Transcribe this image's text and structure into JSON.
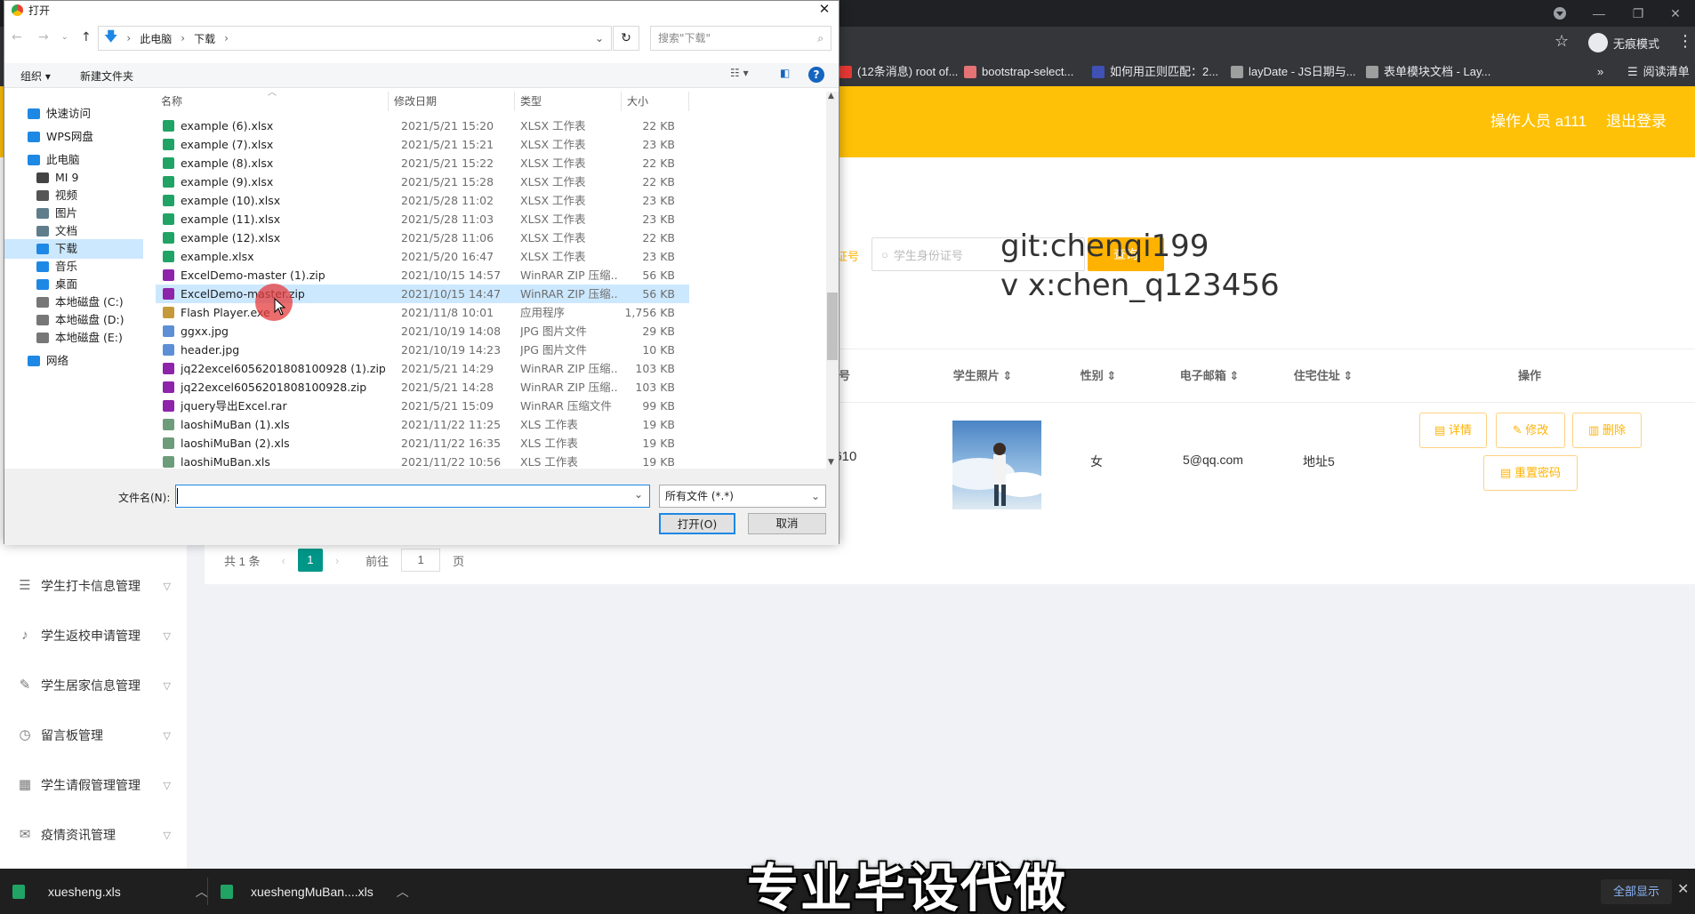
{
  "browser": {
    "incognito_label": "无痕模式",
    "reading_list_label": "阅读清单",
    "bookmarks": [
      "(12条消息) root of...",
      "bootstrap-select...",
      "如何用正则匹配：2...",
      "layDate - JS日期与...",
      "表单模块文档 - Lay..."
    ],
    "bookmark_more": "»",
    "colors": {
      "chrome_bg": "#202124",
      "toolbar_bg": "#35363a"
    }
  },
  "app": {
    "header": {
      "user_label": "操作人员 a111",
      "logout_label": "退出登录",
      "accent": "#ffc107"
    },
    "sidebar_items": [
      {
        "icon": "list-icon",
        "label": "学生打卡信息管理"
      },
      {
        "icon": "microphone-icon",
        "label": "学生返校申请管理"
      },
      {
        "icon": "pencil-icon",
        "label": "学生居家信息管理"
      },
      {
        "icon": "clock-icon",
        "label": "留言板管理"
      },
      {
        "icon": "grid-icon",
        "label": "学生请假管理管理"
      },
      {
        "icon": "mail-icon",
        "label": "疫情资讯管理"
      }
    ],
    "search": {
      "partial_label": "证号",
      "placeholder": "学生身份证号",
      "button_label": "查询"
    },
    "watermark": {
      "line1": "git:chenqi199",
      "line2": "v x:chen_q123456"
    },
    "table": {
      "headers": [
        "证号",
        "学生照片",
        "性别",
        "电子邮箱",
        "住宅住址",
        "操作"
      ],
      "row": {
        "id_partial": "9610",
        "id_partial2": "5",
        "gender": "女",
        "email": "5@qq.com",
        "address": "地址5"
      },
      "actions": {
        "detail": "详情",
        "edit": "修改",
        "delete": "删除",
        "reset": "重置密码"
      }
    },
    "pagination": {
      "total": "共 1 条",
      "current": "1",
      "goto_prefix": "前往",
      "goto_value": "1",
      "goto_suffix": "页"
    }
  },
  "dialog": {
    "title": "打开",
    "breadcrumb": [
      "此电脑",
      "下载"
    ],
    "search_placeholder": "搜索\"下载\"",
    "toolbar": {
      "organize": "组织 ▾",
      "new_folder": "新建文件夹"
    },
    "columns": [
      "名称",
      "修改日期",
      "类型",
      "大小"
    ],
    "nav": [
      {
        "icon": "star-icon",
        "label": "快速访问",
        "indent": 0
      },
      {
        "icon": "cloud-icon",
        "label": "WPS网盘",
        "indent": 0
      },
      {
        "icon": "computer-icon",
        "label": "此电脑",
        "indent": 0
      },
      {
        "icon": "phone-icon",
        "label": "MI 9",
        "indent": 1
      },
      {
        "icon": "video-icon",
        "label": "视频",
        "indent": 1
      },
      {
        "icon": "picture-icon",
        "label": "图片",
        "indent": 1
      },
      {
        "icon": "document-icon",
        "label": "文档",
        "indent": 1
      },
      {
        "icon": "download-icon",
        "label": "下载",
        "indent": 1
      },
      {
        "icon": "music-icon",
        "label": "音乐",
        "indent": 1
      },
      {
        "icon": "desktop-icon",
        "label": "桌面",
        "indent": 1
      },
      {
        "icon": "drive-icon",
        "label": "本地磁盘 (C:)",
        "indent": 1
      },
      {
        "icon": "drive-icon",
        "label": "本地磁盘 (D:)",
        "indent": 1
      },
      {
        "icon": "drive-icon",
        "label": "本地磁盘 (E:)",
        "indent": 1
      },
      {
        "icon": "network-icon",
        "label": "网络",
        "indent": 0
      }
    ],
    "files": [
      {
        "name": "example (6).xlsx",
        "date": "2021/5/21 15:20",
        "type": "XLSX 工作表",
        "size": "22 KB",
        "kind": "xlsx"
      },
      {
        "name": "example (7).xlsx",
        "date": "2021/5/21 15:21",
        "type": "XLSX 工作表",
        "size": "23 KB",
        "kind": "xlsx"
      },
      {
        "name": "example (8).xlsx",
        "date": "2021/5/21 15:22",
        "type": "XLSX 工作表",
        "size": "22 KB",
        "kind": "xlsx"
      },
      {
        "name": "example (9).xlsx",
        "date": "2021/5/21 15:28",
        "type": "XLSX 工作表",
        "size": "22 KB",
        "kind": "xlsx"
      },
      {
        "name": "example (10).xlsx",
        "date": "2021/5/28 11:02",
        "type": "XLSX 工作表",
        "size": "23 KB",
        "kind": "xlsx"
      },
      {
        "name": "example (11).xlsx",
        "date": "2021/5/28 11:03",
        "type": "XLSX 工作表",
        "size": "23 KB",
        "kind": "xlsx"
      },
      {
        "name": "example (12).xlsx",
        "date": "2021/5/28 11:06",
        "type": "XLSX 工作表",
        "size": "22 KB",
        "kind": "xlsx"
      },
      {
        "name": "example.xlsx",
        "date": "2021/5/20 16:47",
        "type": "XLSX 工作表",
        "size": "23 KB",
        "kind": "xlsx"
      },
      {
        "name": "ExcelDemo-master (1).zip",
        "date": "2021/10/15 14:57",
        "type": "WinRAR ZIP 压缩...",
        "size": "56 KB",
        "kind": "zip"
      },
      {
        "name": "ExcelDemo-master.zip",
        "date": "2021/10/15 14:47",
        "type": "WinRAR ZIP 压缩...",
        "size": "56 KB",
        "kind": "zip",
        "selected": true
      },
      {
        "name": "Flash Player.exe",
        "date": "2021/11/8 10:01",
        "type": "应用程序",
        "size": "1,756 KB",
        "kind": "exe"
      },
      {
        "name": "ggxx.jpg",
        "date": "2021/10/19 14:08",
        "type": "JPG 图片文件",
        "size": "29 KB",
        "kind": "jpg"
      },
      {
        "name": "header.jpg",
        "date": "2021/10/19 14:23",
        "type": "JPG 图片文件",
        "size": "10 KB",
        "kind": "jpg"
      },
      {
        "name": "jq22excel6056201808100928 (1).zip",
        "date": "2021/5/21 14:29",
        "type": "WinRAR ZIP 压缩...",
        "size": "103 KB",
        "kind": "zip"
      },
      {
        "name": "jq22excel6056201808100928.zip",
        "date": "2021/5/21 14:28",
        "type": "WinRAR ZIP 压缩...",
        "size": "103 KB",
        "kind": "zip"
      },
      {
        "name": "jquery导出Excel.rar",
        "date": "2021/5/21 15:09",
        "type": "WinRAR 压缩文件",
        "size": "99 KB",
        "kind": "zip"
      },
      {
        "name": "laoshiMuBan (1).xls",
        "date": "2021/11/22 11:25",
        "type": "XLS 工作表",
        "size": "19 KB",
        "kind": "xls"
      },
      {
        "name": "laoshiMuBan (2).xls",
        "date": "2021/11/22 16:35",
        "type": "XLS 工作表",
        "size": "19 KB",
        "kind": "xls"
      },
      {
        "name": "laoshiMuBan.xls",
        "date": "2021/11/22 10:56",
        "type": "XLS 工作表",
        "size": "19 KB",
        "kind": "xls"
      }
    ],
    "filename_label": "文件名(N):",
    "filename_value": "",
    "filter_value": "所有文件 (*.*)",
    "open_label": "打开(O)",
    "cancel_label": "取消"
  },
  "taskbar": {
    "downloads": [
      "xuesheng.xls",
      "xueshengMuBan....xls"
    ],
    "show_all": "全部显示"
  },
  "caption": "专业毕设代做"
}
